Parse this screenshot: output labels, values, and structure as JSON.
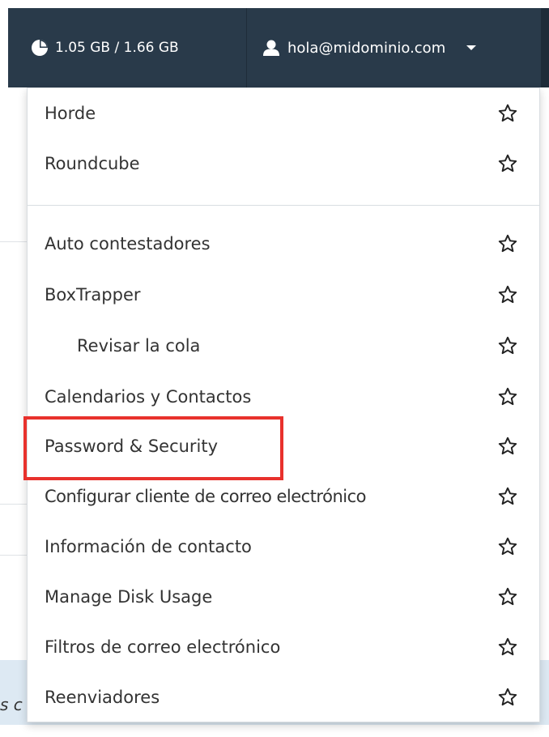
{
  "navbar": {
    "disk_usage": "1.05 GB / 1.66 GB",
    "user_email": "hola@midominio.com",
    "disk_icon": "pie-chart-icon",
    "user_icon": "user-icon"
  },
  "background": {
    "partial_text": "s c"
  },
  "menu": {
    "group1": [
      {
        "label": "Horde"
      },
      {
        "label": "Roundcube"
      }
    ],
    "group2": [
      {
        "label": "Auto contestadores"
      },
      {
        "label": "BoxTrapper"
      },
      {
        "label": "Revisar la cola"
      },
      {
        "label": "Calendarios y Contactos"
      },
      {
        "label": "Password & Security"
      },
      {
        "label": "Configurar cliente de correo electrónico"
      },
      {
        "label": "Información de contacto"
      },
      {
        "label": "Manage Disk Usage"
      },
      {
        "label": "Filtros de correo electrónico"
      },
      {
        "label": "Reenviadores"
      }
    ],
    "star_icon": "star-outline-icon"
  },
  "colors": {
    "navbar_bg": "#293a4a",
    "highlight": "#e8312c",
    "text": "#333333"
  }
}
